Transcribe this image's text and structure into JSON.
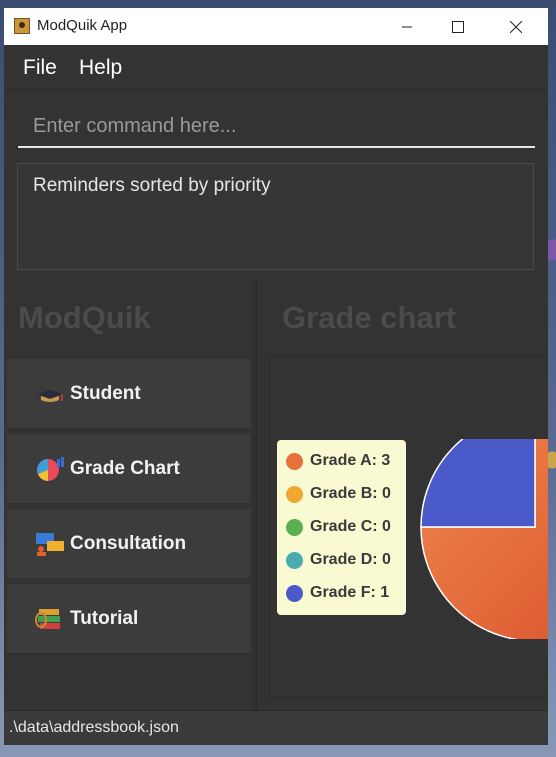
{
  "window": {
    "title": "ModQuik App"
  },
  "menu": {
    "items": [
      "File",
      "Help"
    ]
  },
  "command": {
    "placeholder": "Enter command here..."
  },
  "result": {
    "text": "Reminders sorted by priority"
  },
  "sidebar": {
    "title": "ModQuik",
    "items": [
      {
        "label": "Student",
        "icon": "graduation-cap-icon"
      },
      {
        "label": "Grade Chart",
        "icon": "pie-chart-icon"
      },
      {
        "label": "Consultation",
        "icon": "consultation-icon"
      },
      {
        "label": "Tutorial",
        "icon": "books-icon"
      }
    ]
  },
  "chart_panel": {
    "title": "Grade chart"
  },
  "chart_data": {
    "type": "pie",
    "labels": [
      "Grade A",
      "Grade B",
      "Grade C",
      "Grade D",
      "Grade F"
    ],
    "values": [
      3,
      0,
      0,
      0,
      1
    ],
    "legend_labels": [
      "Grade A: 3",
      "Grade B: 0",
      "Grade C: 0",
      "Grade D: 0",
      "Grade F: 1"
    ],
    "colors": [
      "#e8703a",
      "#f0a830",
      "#5ab050",
      "#4aabb0",
      "#4a5ac8"
    ],
    "legend": "left"
  },
  "status": {
    "path": ".\\data\\addressbook.json"
  }
}
